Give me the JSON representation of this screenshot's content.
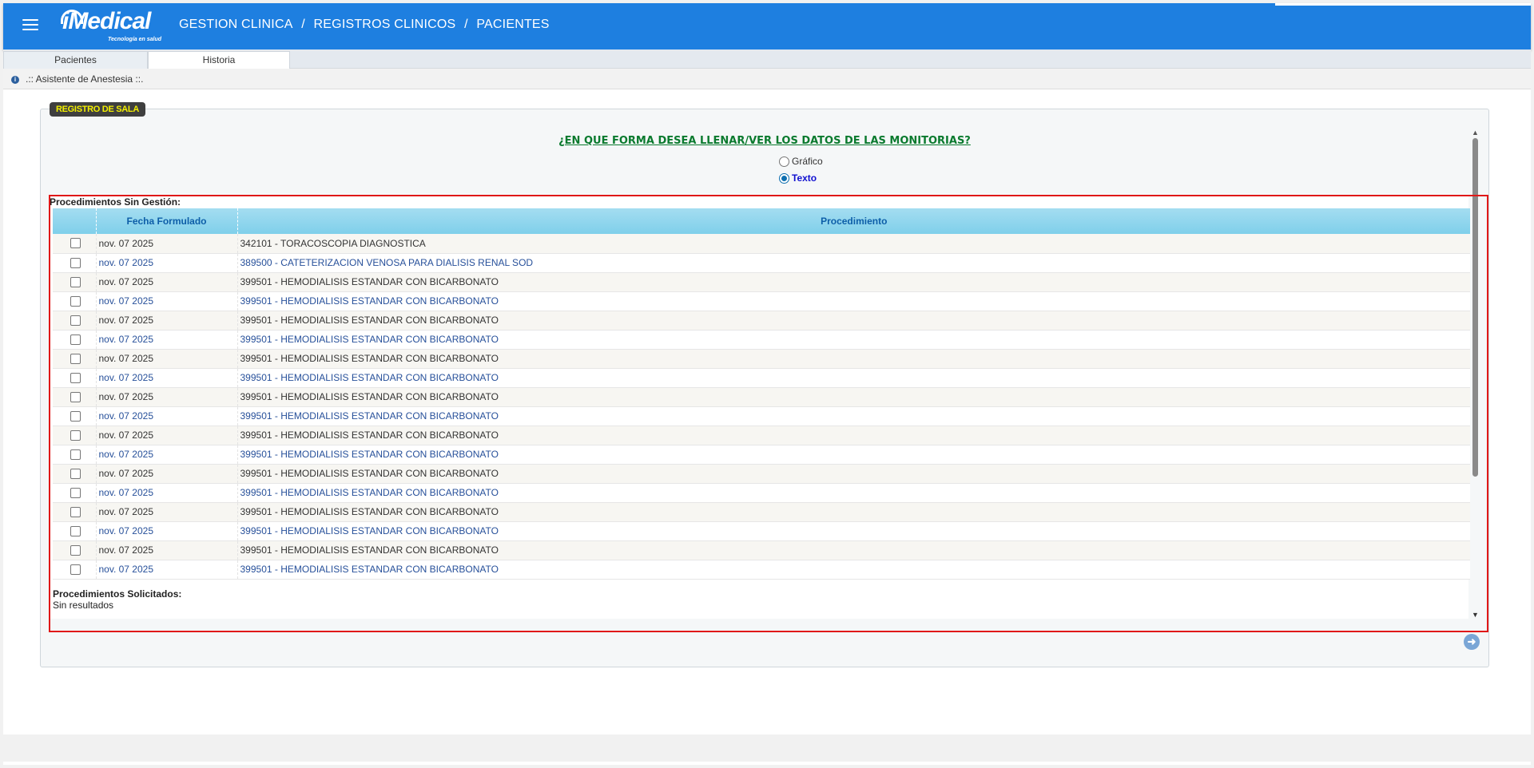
{
  "header": {
    "logo_text": "iMedical",
    "logo_tagline": "Tecnología en salud",
    "breadcrumb": [
      "GESTION CLINICA",
      "/",
      "REGISTROS CLINICOS",
      "/",
      "PACIENTES"
    ]
  },
  "tabs": [
    {
      "label": "Pacientes",
      "active": false
    },
    {
      "label": "Historia",
      "active": true
    }
  ],
  "subheader": {
    "title": ".:: Asistente de Anestesia ::."
  },
  "panel": {
    "badge": "REGISTRO DE SALA",
    "question": "¿EN QUE FORMA DESEA LLENAR/VER LOS DATOS DE LAS MONITORIAS?",
    "options": [
      {
        "label": "Gráfico",
        "selected": false
      },
      {
        "label": "Texto",
        "selected": true
      }
    ]
  },
  "procedimientos_sin_gestion": {
    "title": "Procedimientos Sin Gestión:",
    "columns": [
      "",
      "Fecha Formulado",
      "Procedimiento"
    ],
    "rows": [
      {
        "fecha": "nov. 07 2025",
        "procedimiento": "342101 - TORACOSCOPIA DIAGNOSTICA"
      },
      {
        "fecha": "nov. 07 2025",
        "procedimiento": "389500 - CATETERIZACION VENOSA PARA DIALISIS RENAL SOD"
      },
      {
        "fecha": "nov. 07 2025",
        "procedimiento": "399501 - HEMODIALISIS ESTANDAR CON BICARBONATO"
      },
      {
        "fecha": "nov. 07 2025",
        "procedimiento": "399501 - HEMODIALISIS ESTANDAR CON BICARBONATO"
      },
      {
        "fecha": "nov. 07 2025",
        "procedimiento": "399501 - HEMODIALISIS ESTANDAR CON BICARBONATO"
      },
      {
        "fecha": "nov. 07 2025",
        "procedimiento": "399501 - HEMODIALISIS ESTANDAR CON BICARBONATO"
      },
      {
        "fecha": "nov. 07 2025",
        "procedimiento": "399501 - HEMODIALISIS ESTANDAR CON BICARBONATO"
      },
      {
        "fecha": "nov. 07 2025",
        "procedimiento": "399501 - HEMODIALISIS ESTANDAR CON BICARBONATO"
      },
      {
        "fecha": "nov. 07 2025",
        "procedimiento": "399501 - HEMODIALISIS ESTANDAR CON BICARBONATO"
      },
      {
        "fecha": "nov. 07 2025",
        "procedimiento": "399501 - HEMODIALISIS ESTANDAR CON BICARBONATO"
      },
      {
        "fecha": "nov. 07 2025",
        "procedimiento": "399501 - HEMODIALISIS ESTANDAR CON BICARBONATO"
      },
      {
        "fecha": "nov. 07 2025",
        "procedimiento": "399501 - HEMODIALISIS ESTANDAR CON BICARBONATO"
      },
      {
        "fecha": "nov. 07 2025",
        "procedimiento": "399501 - HEMODIALISIS ESTANDAR CON BICARBONATO"
      },
      {
        "fecha": "nov. 07 2025",
        "procedimiento": "399501 - HEMODIALISIS ESTANDAR CON BICARBONATO"
      },
      {
        "fecha": "nov. 07 2025",
        "procedimiento": "399501 - HEMODIALISIS ESTANDAR CON BICARBONATO"
      },
      {
        "fecha": "nov. 07 2025",
        "procedimiento": "399501 - HEMODIALISIS ESTANDAR CON BICARBONATO"
      },
      {
        "fecha": "nov. 07 2025",
        "procedimiento": "399501 - HEMODIALISIS ESTANDAR CON BICARBONATO"
      },
      {
        "fecha": "nov. 07 2025",
        "procedimiento": "399501 - HEMODIALISIS ESTANDAR CON BICARBONATO"
      }
    ]
  },
  "procedimientos_solicitados": {
    "title": "Procedimientos Solicitados:",
    "empty_text": "Sin resultados"
  },
  "icons": {
    "menu": "hamburger-menu-icon",
    "info": "info-icon",
    "next": "arrow-right-circle-icon"
  },
  "colors": {
    "header_bg": "#1e7fe0",
    "badge_text": "#f4f000",
    "question": "#0a7a2e",
    "highlight_border": "#e01818",
    "table_header": "#a4ddf1"
  }
}
